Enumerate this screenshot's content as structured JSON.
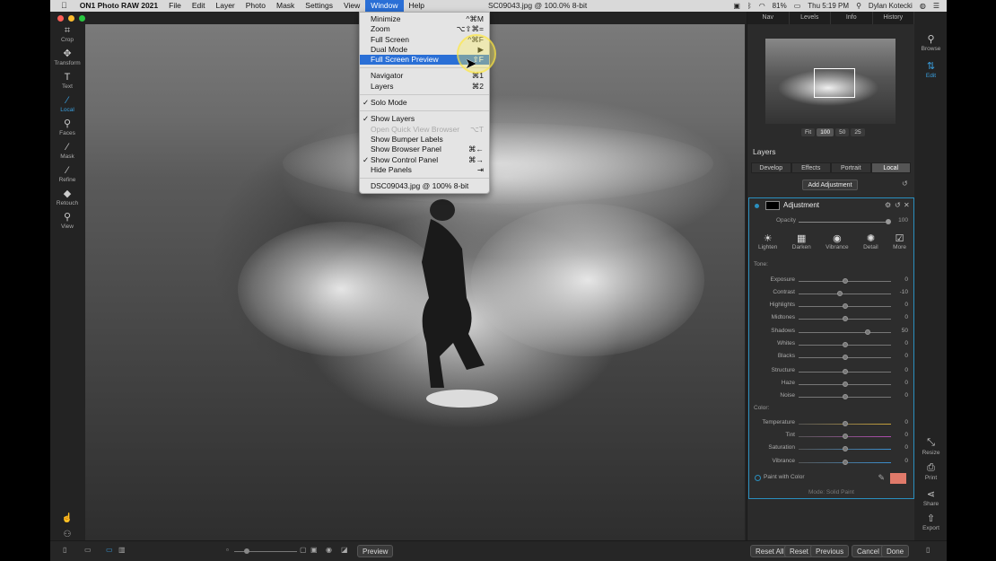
{
  "menubar": {
    "apple": "",
    "app_name": "ON1 Photo RAW 2021",
    "items": [
      "File",
      "Edit",
      "Layer",
      "Photo",
      "Mask",
      "Settings",
      "View",
      "Window",
      "Help"
    ],
    "active_menu": "Window",
    "doc_title": "SC09043.jpg @ 100.0% 8-bit",
    "battery": "81%",
    "clock": "Thu 5:19 PM",
    "user": "Dylan Kotecki"
  },
  "window_menu": {
    "items": [
      {
        "label": "Minimize",
        "shortcut": "^⌘M",
        "check": "",
        "state": "normal"
      },
      {
        "label": "Zoom",
        "shortcut": "⌥⇧⌘=",
        "check": "",
        "state": "normal"
      },
      {
        "label": "Full Screen",
        "shortcut": "^⌘F",
        "check": "",
        "state": "normal"
      },
      {
        "label": "Dual Mode",
        "shortcut": "▶",
        "check": "",
        "state": "normal"
      },
      {
        "label": "Full Screen Preview",
        "shortcut": "⇧F",
        "check": "",
        "state": "highlighted"
      },
      {
        "sep": true
      },
      {
        "label": "Navigator",
        "shortcut": "⌘1",
        "check": "",
        "state": "normal"
      },
      {
        "label": "Layers",
        "shortcut": "⌘2",
        "check": "",
        "state": "normal"
      },
      {
        "sep": true
      },
      {
        "label": "Solo Mode",
        "shortcut": "",
        "check": "✓",
        "state": "normal"
      },
      {
        "sep": true
      },
      {
        "label": "Show Layers",
        "shortcut": "",
        "check": "✓",
        "state": "normal"
      },
      {
        "label": "Open Quick View Browser",
        "shortcut": "⌥T",
        "check": "",
        "state": "disabled"
      },
      {
        "label": "Show Bumper Labels",
        "shortcut": "",
        "check": "",
        "state": "normal"
      },
      {
        "label": "Show Browser Panel",
        "shortcut": "⌘←",
        "check": "",
        "state": "normal"
      },
      {
        "label": "Show Control Panel",
        "shortcut": "⌘→",
        "check": "✓",
        "state": "normal"
      },
      {
        "label": "Hide Panels",
        "shortcut": "⇥",
        "check": "",
        "state": "normal"
      },
      {
        "sep": true
      },
      {
        "label": "DSC09043.jpg @ 100% 8-bit",
        "shortcut": "",
        "check": "",
        "state": "normal"
      }
    ]
  },
  "left_tools": [
    {
      "icon": "crop-icon",
      "glyph": "⌗",
      "label": "Crop",
      "active": false
    },
    {
      "icon": "transform-icon",
      "glyph": "✥",
      "label": "Transform",
      "active": false
    },
    {
      "icon": "text-icon",
      "glyph": "T",
      "label": "Text",
      "active": false
    },
    {
      "icon": "local-brush-icon",
      "glyph": "⁄",
      "label": "Local",
      "active": true
    },
    {
      "icon": "faces-icon",
      "glyph": "⚲",
      "label": "Faces",
      "active": false
    },
    {
      "icon": "mask-brush-icon",
      "glyph": "⁄",
      "label": "Mask",
      "active": false
    },
    {
      "icon": "refine-icon",
      "glyph": "⁄",
      "label": "Refine",
      "active": false
    },
    {
      "icon": "retouch-icon",
      "glyph": "◆",
      "label": "Retouch",
      "active": false
    },
    {
      "icon": "view-icon",
      "glyph": "⚲",
      "label": "View",
      "active": false
    }
  ],
  "right_strip": {
    "browse": "Browse",
    "edit": "Edit",
    "resize": "Resize",
    "print": "Print",
    "share": "Share",
    "export": "Export"
  },
  "panel": {
    "tabs": [
      "Nav",
      "Levels",
      "Info",
      "History"
    ],
    "zoom_options": [
      "Fit",
      "100",
      "50",
      "25"
    ],
    "zoom_selected": "100",
    "layers_title": "Layers",
    "mode_tabs": [
      "Develop",
      "Effects",
      "Portrait",
      "Local"
    ],
    "mode_selected": "Local",
    "add_adjustment": "Add Adjustment",
    "adjustment": {
      "name": "Adjustment",
      "opacity_label": "Opacity",
      "opacity_value": "100",
      "opacity_fraction": 1.0,
      "presets": [
        {
          "icon": "lighten-icon",
          "glyph": "☀",
          "label": "Lighten"
        },
        {
          "icon": "darken-icon",
          "glyph": "▦",
          "label": "Darken"
        },
        {
          "icon": "vibrance-icon",
          "glyph": "◉",
          "label": "Vibrance"
        },
        {
          "icon": "detail-icon",
          "glyph": "✺",
          "label": "Detail"
        },
        {
          "icon": "more-icon",
          "glyph": "☑",
          "label": "More"
        }
      ],
      "tone_label": "Tone:",
      "color_label": "Color:",
      "sliders": [
        {
          "label": "Exposure",
          "value": "0",
          "pos": 0.5,
          "group": "tone"
        },
        {
          "label": "Contrast",
          "value": "-10",
          "pos": 0.45,
          "group": "tone"
        },
        {
          "label": "Highlights",
          "value": "0",
          "pos": 0.5,
          "group": "tone"
        },
        {
          "label": "Midtones",
          "value": "0",
          "pos": 0.5,
          "group": "tone"
        },
        {
          "label": "Shadows",
          "value": "50",
          "pos": 0.75,
          "group": "tone"
        },
        {
          "label": "Whites",
          "value": "0",
          "pos": 0.5,
          "group": "tone"
        },
        {
          "label": "Blacks",
          "value": "0",
          "pos": 0.5,
          "group": "tone"
        },
        {
          "label": "Structure",
          "value": "0",
          "pos": 0.5,
          "group": "detail"
        },
        {
          "label": "Haze",
          "value": "0",
          "pos": 0.5,
          "group": "detail"
        },
        {
          "label": "Noise",
          "value": "0",
          "pos": 0.5,
          "group": "detail"
        },
        {
          "label": "Temperature",
          "value": "0",
          "pos": 0.5,
          "group": "color",
          "color": "#c8a23a"
        },
        {
          "label": "Tint",
          "value": "0",
          "pos": 0.5,
          "group": "color",
          "color": "#b04bb0"
        },
        {
          "label": "Saturation",
          "value": "0",
          "pos": 0.5,
          "group": "color",
          "color": "#3a8fd0"
        },
        {
          "label": "Vibrance",
          "value": "0",
          "pos": 0.5,
          "group": "color",
          "color": "#3a8fd0"
        }
      ],
      "paint_label": "Paint with Color",
      "paint_color": "#e07a6a",
      "mode_line": "Mode: Solid Paint"
    }
  },
  "bottombar": {
    "preview": "Preview",
    "reset_all": "Reset All",
    "reset": "Reset",
    "previous": "Previous",
    "cancel": "Cancel",
    "done": "Done"
  }
}
